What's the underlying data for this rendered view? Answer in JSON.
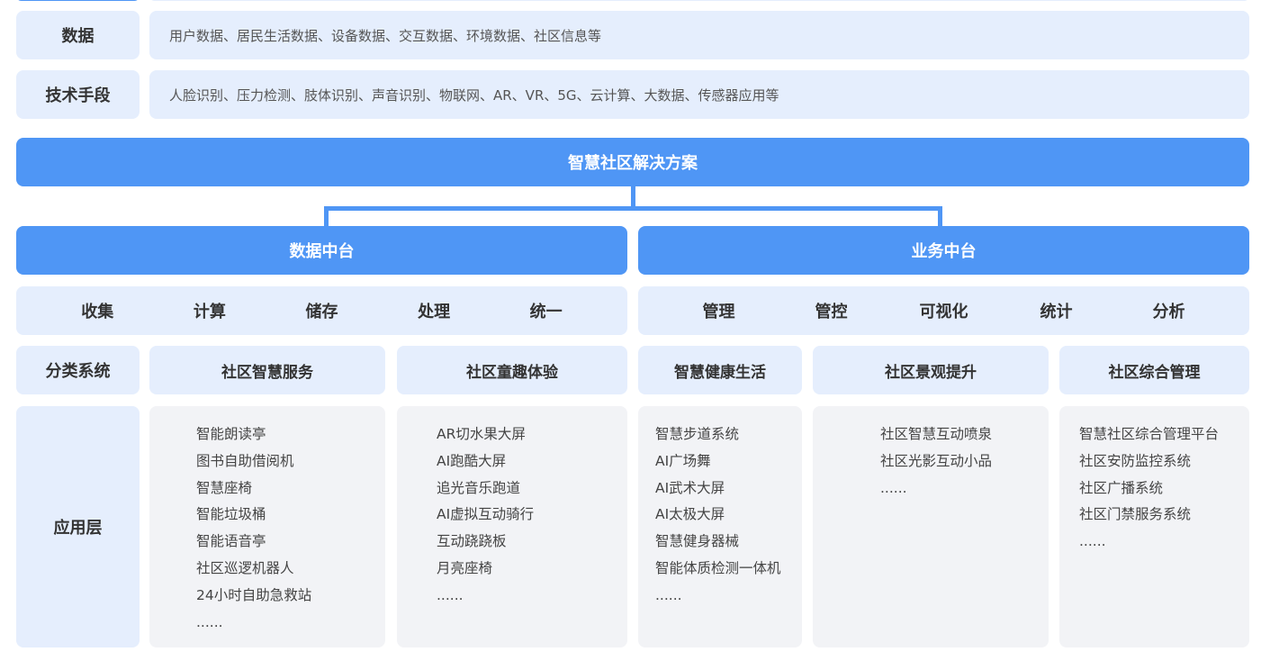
{
  "rows": {
    "data": {
      "label": "数据",
      "desc": "用户数据、居民生活数据、设备数据、交互数据、环境数据、社区信息等"
    },
    "tech": {
      "label": "技术手段",
      "desc": "人脸识别、压力检测、肢体识别、声音识别、物联网、AR、VR、5G、云计算、大数据、传感器应用等"
    }
  },
  "solution": {
    "title": "智慧社区解决方案"
  },
  "data_platform": {
    "title": "数据中台",
    "items": [
      "收集",
      "计算",
      "储存",
      "处理",
      "统一"
    ]
  },
  "business_platform": {
    "title": "业务中台",
    "items": [
      "管理",
      "管控",
      "可视化",
      "统计",
      "分析"
    ]
  },
  "classification": {
    "label": "分类系统"
  },
  "application": {
    "label": "应用层"
  },
  "categories": [
    {
      "name": "社区智慧服务",
      "apps": [
        "智能朗读亭",
        "图书自助借阅机",
        "智慧座椅",
        "智能垃圾桶",
        "智能语音亭",
        "社区巡逻机器人",
        "24小时自助急救站",
        "......"
      ]
    },
    {
      "name": "社区童趣体验",
      "apps": [
        "AR切水果大屏",
        "AI跑酷大屏",
        "追光音乐跑道",
        "AI虚拟互动骑行",
        "互动跷跷板",
        "月亮座椅",
        "......"
      ]
    },
    {
      "name": "智慧健康生活",
      "apps": [
        "智慧步道系统",
        "AI广场舞",
        "AI武术大屏",
        "AI太极大屏",
        "智慧健身器械",
        "智能体质检测一体机",
        "......"
      ]
    },
    {
      "name": "社区景观提升",
      "apps": [
        "社区智慧互动喷泉",
        "社区光影互动小品",
        "......"
      ]
    },
    {
      "name": "社区综合管理",
      "apps": [
        "智慧社区综合管理平台",
        "社区安防监控系统",
        "社区广播系统",
        "社区门禁服务系统",
        "......"
      ]
    }
  ]
}
